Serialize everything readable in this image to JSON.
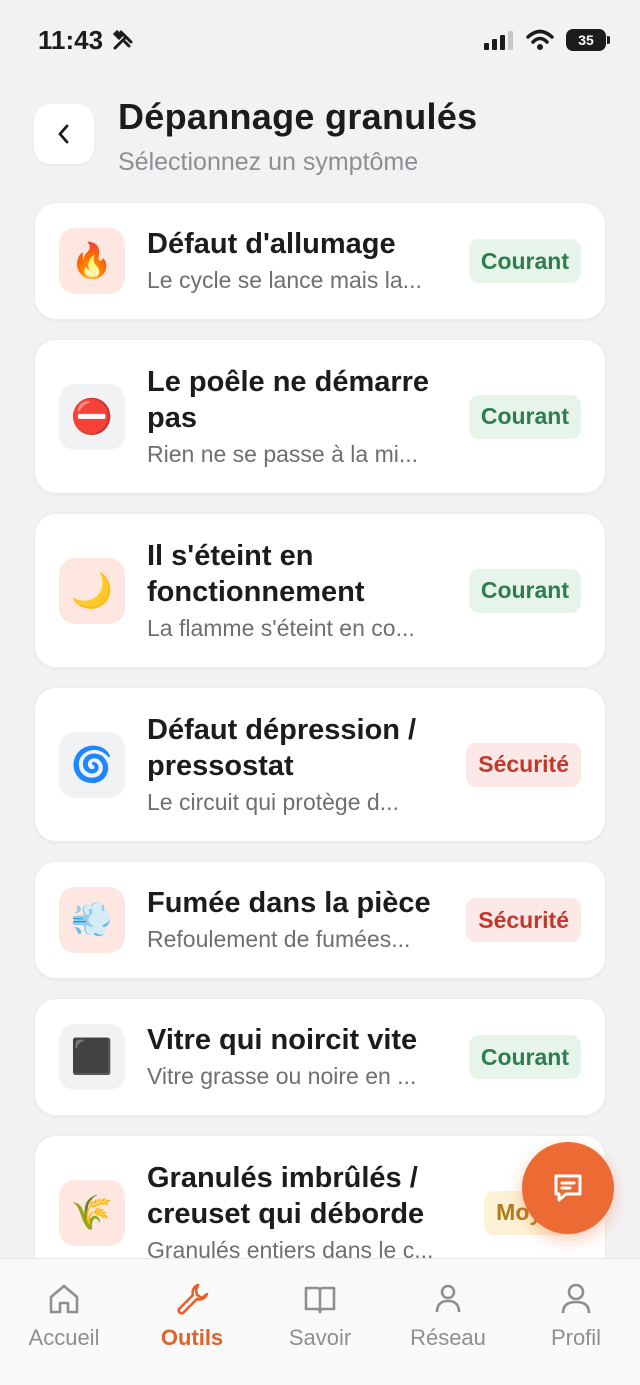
{
  "status_bar": {
    "time": "11:43",
    "battery": "35"
  },
  "header": {
    "title": "Dépannage granulés",
    "subtitle": "Sélectionnez un symptôme"
  },
  "symptoms": [
    {
      "icon": "🔥",
      "icon_name": "fire-icon",
      "bg": "warm",
      "title": "Défaut d'allumage",
      "desc": "Le cycle se lance mais la...",
      "badge": "Courant",
      "badge_type": "courant"
    },
    {
      "icon": "⛔",
      "icon_name": "no-entry-icon",
      "bg": "gray",
      "title": "Le poêle ne démarre pas",
      "desc": "Rien ne se passe à la mi...",
      "badge": "Courant",
      "badge_type": "courant"
    },
    {
      "icon": "🌙",
      "icon_name": "moon-icon",
      "bg": "warm",
      "title": "Il s'éteint en fonctionnement",
      "desc": "La flamme s'éteint en co...",
      "badge": "Courant",
      "badge_type": "courant"
    },
    {
      "icon": "🌀",
      "icon_name": "cyclone-icon",
      "bg": "gray",
      "title": "Défaut dépression / pressostat",
      "desc": "Le circuit qui protège d...",
      "badge": "Sécurité",
      "badge_type": "securite"
    },
    {
      "icon": "💨",
      "icon_name": "smoke-icon",
      "bg": "warm",
      "title": "Fumée dans la pièce",
      "desc": "Refoulement de fumées...",
      "badge": "Sécurité",
      "badge_type": "securite"
    },
    {
      "icon": "⬛",
      "icon_name": "black-square-icon",
      "bg": "gray",
      "title": "Vitre qui noircit vite",
      "desc": "Vitre grasse ou noire en ...",
      "badge": "Courant",
      "badge_type": "courant"
    },
    {
      "icon": "🌾",
      "icon_name": "rice-icon",
      "bg": "warm",
      "title": "Granulés imbrûlés / creuset qui déborde",
      "desc": "Granulés entiers dans le c...",
      "badge": "Moyen",
      "badge_type": "moyen"
    }
  ],
  "tabs": [
    {
      "label": "Accueil",
      "icon_name": "home-icon"
    },
    {
      "label": "Outils",
      "icon_name": "wrench-icon"
    },
    {
      "label": "Savoir",
      "icon_name": "book-icon"
    },
    {
      "label": "Réseau",
      "icon_name": "user-icon"
    },
    {
      "label": "Profil",
      "icon_name": "profile-icon"
    }
  ],
  "active_tab": "Outils",
  "colors": {
    "accent": "#e5602a",
    "fab": "#ec6a33"
  }
}
